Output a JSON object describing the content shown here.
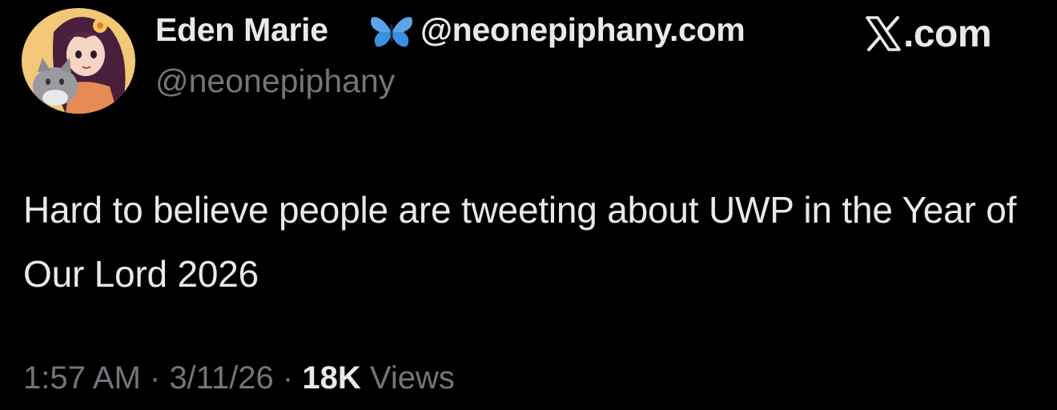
{
  "author": {
    "display_name": "Eden Marie",
    "website": "@neonepiphany.com",
    "handle": "@neonepiphany",
    "badge_icon": "butterfly-icon",
    "avatar_icon": "illustrated-avatar-woman-with-cat"
  },
  "brand": {
    "logo_icon": "x-logo-icon",
    "text": ".com"
  },
  "tweet": {
    "text": "Hard to believe people are tweeting about UWP in the Year of Our Lord 2026"
  },
  "meta": {
    "time": "1:57 AM",
    "separator_1": " · ",
    "date": "3/11/26",
    "separator_2": " · ",
    "views_count": "18K",
    "views_label": " Views"
  },
  "colors": {
    "background": "#000000",
    "primary_text": "#e7e9ea",
    "secondary_text": "#71767b",
    "butterfly_blue": "#3d8fe0"
  }
}
